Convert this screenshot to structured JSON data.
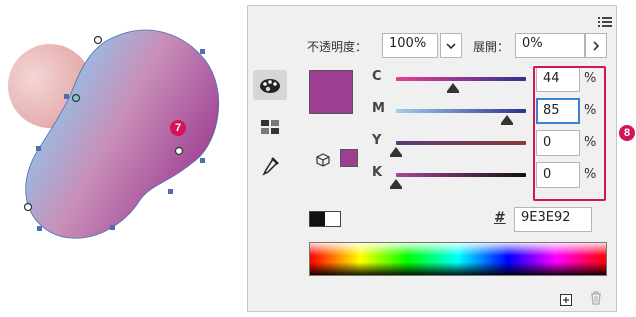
{
  "callouts": {
    "left": "7",
    "right": "8"
  },
  "colors": {
    "fill": "#9E3E92",
    "callout": "#d4145a",
    "highlight": "#d4145a",
    "focus": "#3b82d6"
  },
  "toolbar": {
    "opacity_label": "不透明度：",
    "opacity_value": "100%",
    "spread_label": "展開：",
    "spread_value": "0%",
    "menu_icon": "list-menu-icon",
    "dropdown_icon": "chevron-down-icon",
    "more_icon": "chevron-right-icon"
  },
  "tools": [
    {
      "name": "color-palette-tool-icon",
      "active": true
    },
    {
      "name": "swatches-tool-icon",
      "active": false
    },
    {
      "name": "eyedropper-tool-icon",
      "active": false
    }
  ],
  "sliders": [
    {
      "channel": "C",
      "value": "44",
      "level": 0.44,
      "unit": "%"
    },
    {
      "channel": "M",
      "value": "85",
      "level": 0.85,
      "unit": "%",
      "focused": true
    },
    {
      "channel": "Y",
      "value": "0",
      "level": 0.0,
      "unit": "%"
    },
    {
      "channel": "K",
      "value": "0",
      "level": 0.0,
      "unit": "%"
    }
  ],
  "hex": {
    "label": "#",
    "value": "9E3E92"
  },
  "footer": {
    "add_icon": "add-swatch-icon",
    "delete_icon": "trash-icon"
  },
  "misc_icons": [
    "cube-3d-icon",
    "black-white-swatch-icon"
  ]
}
